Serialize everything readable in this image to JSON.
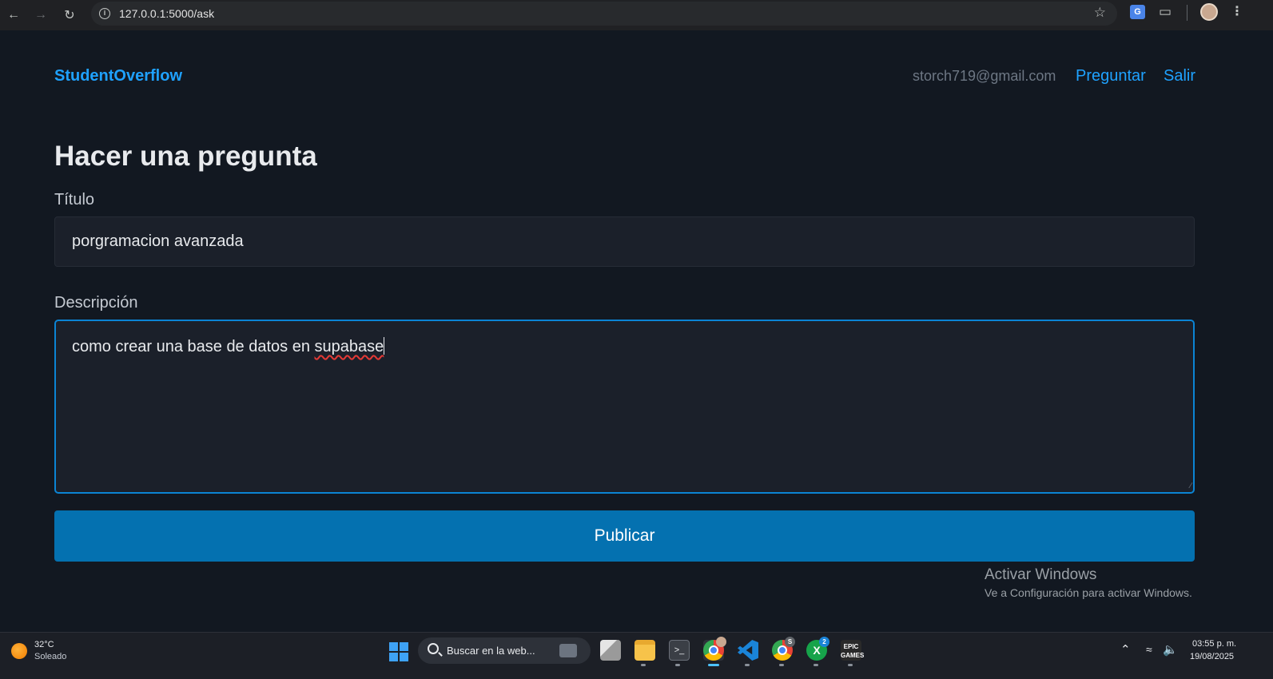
{
  "browser": {
    "url": "127.0.0.1:5000/ask",
    "icons": {
      "back": "arrow-left",
      "forward": "arrow-right",
      "reload": "reload",
      "site_info": "info",
      "bookmark": "star",
      "translate": "google-translate",
      "extensions": "puzzle",
      "profile": "avatar",
      "menu": "three-dots"
    }
  },
  "header": {
    "brand": "StudentOverflow",
    "user_email": "storch719@gmail.com",
    "nav": {
      "ask": "Preguntar",
      "logout": "Salir"
    }
  },
  "form": {
    "heading": "Hacer una pregunta",
    "title_label": "Título",
    "title_value": "porgramacion avanzada",
    "description_label": "Descripción",
    "description_prefix": "como crear una base de datos en ",
    "description_misspelled": "supabase",
    "submit_label": "Publicar"
  },
  "watermark": {
    "title": "Activar Windows",
    "subtitle": "Ve a Configuración para activar Windows."
  },
  "taskbar": {
    "weather": {
      "temperature": "32°C",
      "condition": "Soleado"
    },
    "search_placeholder": "Buscar en la web...",
    "apps": [
      "task-view",
      "file-explorer",
      "terminal",
      "chrome",
      "vscode",
      "chrome-profile",
      "xbox",
      "epic-games"
    ],
    "badges": {
      "chrome_profile": "S",
      "xbox": "2"
    },
    "clock": {
      "time": "03:55 p. m.",
      "date": "19/08/2025"
    }
  },
  "colors": {
    "page_bg": "#121821",
    "accent": "#1fa2ff",
    "button": "#0471b0",
    "input_bg": "#1b202a",
    "focus_border": "#0b84d4"
  }
}
